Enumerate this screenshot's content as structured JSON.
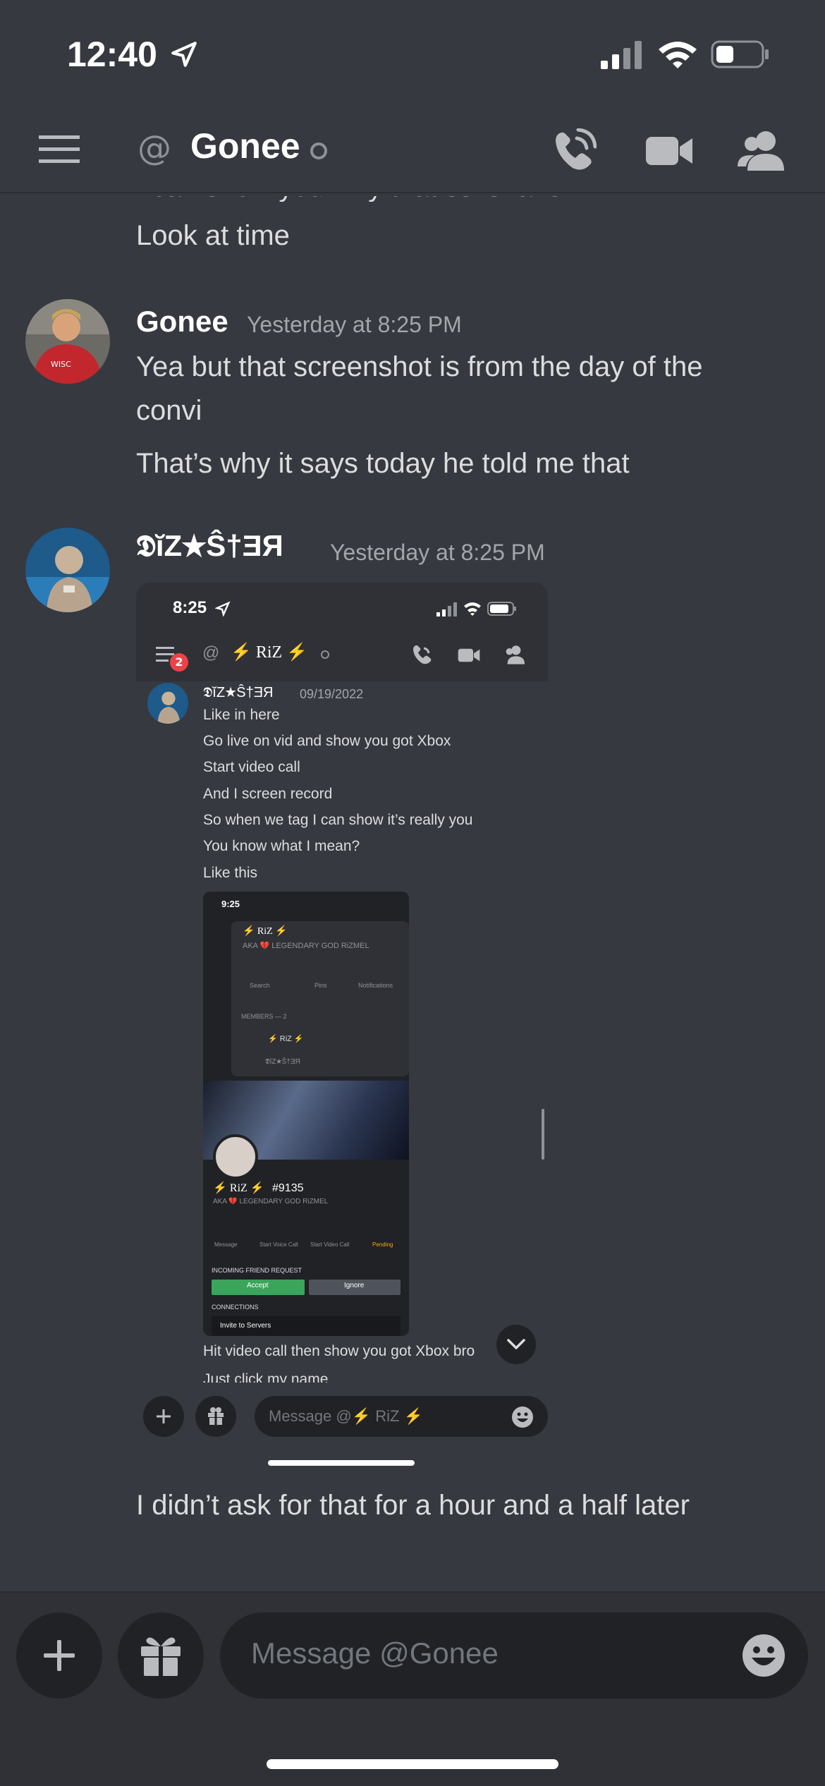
{
  "status_bar": {
    "time": "12:40"
  },
  "header": {
    "at_symbol": "@",
    "title": "Gonee"
  },
  "messages": {
    "cut_line": "I can show you why that ss is fake",
    "line_look": "Look at time",
    "msg1": {
      "author": "Gonee",
      "timestamp": "Yesterday at 8:25 PM",
      "line1": "Yea but that screenshot is from the day of the",
      "line2": "convi",
      "line3": "That’s why it says today he told me that"
    },
    "msg2": {
      "author": "𝕯ĭZ★Ŝ†ƎЯ",
      "timestamp": "Yesterday at 8:25 PM"
    },
    "after_embed": "I didn’t ask for that for a hour and a half later"
  },
  "embed": {
    "time": "8:25",
    "badge": "2",
    "at": "@",
    "channel": "⚡ RiZ ⚡",
    "author": "𝕯ĭZ★Ŝ†ƎЯ",
    "timestamp": "09/19/2022",
    "lines": [
      "Like in here",
      "Go live on vid and show you got Xbox",
      "Start video call",
      "And I screen record",
      "So when we tag I can show it’s really you",
      "You know what I mean?",
      "Like this"
    ],
    "after_lines": [
      "Hit video call then show you got Xbox bro",
      "Just click my name"
    ],
    "placeholder": "Message @⚡ RiZ ⚡",
    "phone": {
      "time": "9:25",
      "name": "⚡ RiZ ⚡",
      "aka": "AKA 💔 LEGENDARY GOD RiZMEL",
      "tabs": [
        "Search",
        "Pins",
        "Notifications"
      ],
      "members_label": "MEMBERS — 2",
      "member1": "⚡ RiZ ⚡",
      "member2": "𝕯ĭZ★Ŝ†ƎЯ",
      "profile_name": "⚡ RiZ ⚡",
      "discriminator": "#9135",
      "profile_aka": "AKA 💔 LEGENDARY GOD RiZMEL",
      "actions": [
        "Message",
        "Start Voice Call",
        "Start Video Call",
        "Pending"
      ],
      "friend_request_label": "INCOMING FRIEND REQUEST",
      "accept": "Accept",
      "ignore": "Ignore",
      "connections_label": "CONNECTIONS",
      "invite": "Invite to Servers"
    }
  },
  "composer": {
    "placeholder": "Message @Gonee"
  },
  "colors": {
    "background": "#36393f",
    "input": "#202225",
    "accept": "#3ba55c"
  }
}
